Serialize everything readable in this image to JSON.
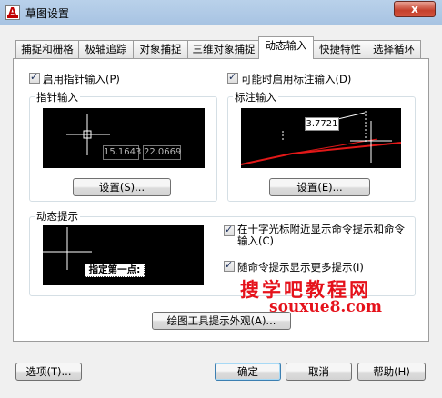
{
  "window": {
    "title": "草图设置",
    "close_glyph": "x"
  },
  "tabs": [
    {
      "label": "捕捉和栅格"
    },
    {
      "label": "极轴追踪"
    },
    {
      "label": "对象捕捉"
    },
    {
      "label": "三维对象捕捉"
    },
    {
      "label": "动态输入"
    },
    {
      "label": "快捷特性"
    },
    {
      "label": "选择循环"
    }
  ],
  "active_tab": 4,
  "pointer_input": {
    "enable_label": "启用指针输入(P)",
    "enabled": true,
    "group_title": "指针输入",
    "preview_values": [
      "15.1643",
      "22.0669"
    ],
    "settings_button": "设置(S)..."
  },
  "dimension_input": {
    "enable_label": "可能时启用标注输入(D)",
    "enabled": true,
    "group_title": "标注输入",
    "preview_value": "3.7721",
    "settings_button": "设置(E)..."
  },
  "dynamic_prompts": {
    "group_title": "动态提示",
    "preview_prompt": "指定第一点:",
    "options": [
      {
        "label_line1": "在十字光标附近显示命令提示和命令",
        "label_line2": "输入(C)",
        "checked": true
      },
      {
        "label_line1": "随命令提示显示更多提示(I)",
        "checked": true
      }
    ]
  },
  "tooltip_button": "绘图工具提示外观(A)...",
  "footer": {
    "options_button": "选项(T)...",
    "ok_button": "确定",
    "cancel_button": "取消",
    "help_button": "帮助(H)"
  },
  "watermark": {
    "line1": "搜学吧教程网",
    "line2": "souxue8.com",
    "color": "#e5121b"
  }
}
